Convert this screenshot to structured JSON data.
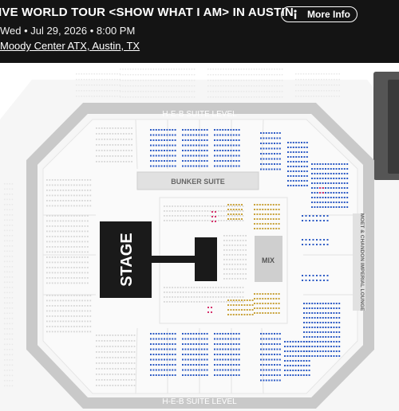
{
  "event": {
    "title": "IVE WORLD TOUR <SHOW WHAT I AM> IN AUSTIN",
    "datetime": "Wed • Jul 29, 2026 • 8:00 PM",
    "venue_link": "Moody Center ATX, Austin, TX",
    "more_info_label": "More Info",
    "info_icon": "info-icon"
  },
  "seat_map": {
    "suite_label_top": "H-E-B SUITE LEVEL",
    "suite_label_bottom": "H-E-B SUITE LEVEL",
    "bunker_label": "BUNKER SUITE",
    "stage_label": "STAGE",
    "mix_label": "MIX",
    "lounge_label": "MOET & CHANDON IMPERIAL LOUNGE",
    "colors": {
      "header_bg": "#141414",
      "available_seat": "#2e5cc5",
      "premium_seat": "#c9a33b",
      "hot_seat": "#d6336c",
      "unavailable_seat": "#d6d6d6",
      "stage": "#1a1a1a",
      "ring": "#c9c9c9"
    }
  }
}
